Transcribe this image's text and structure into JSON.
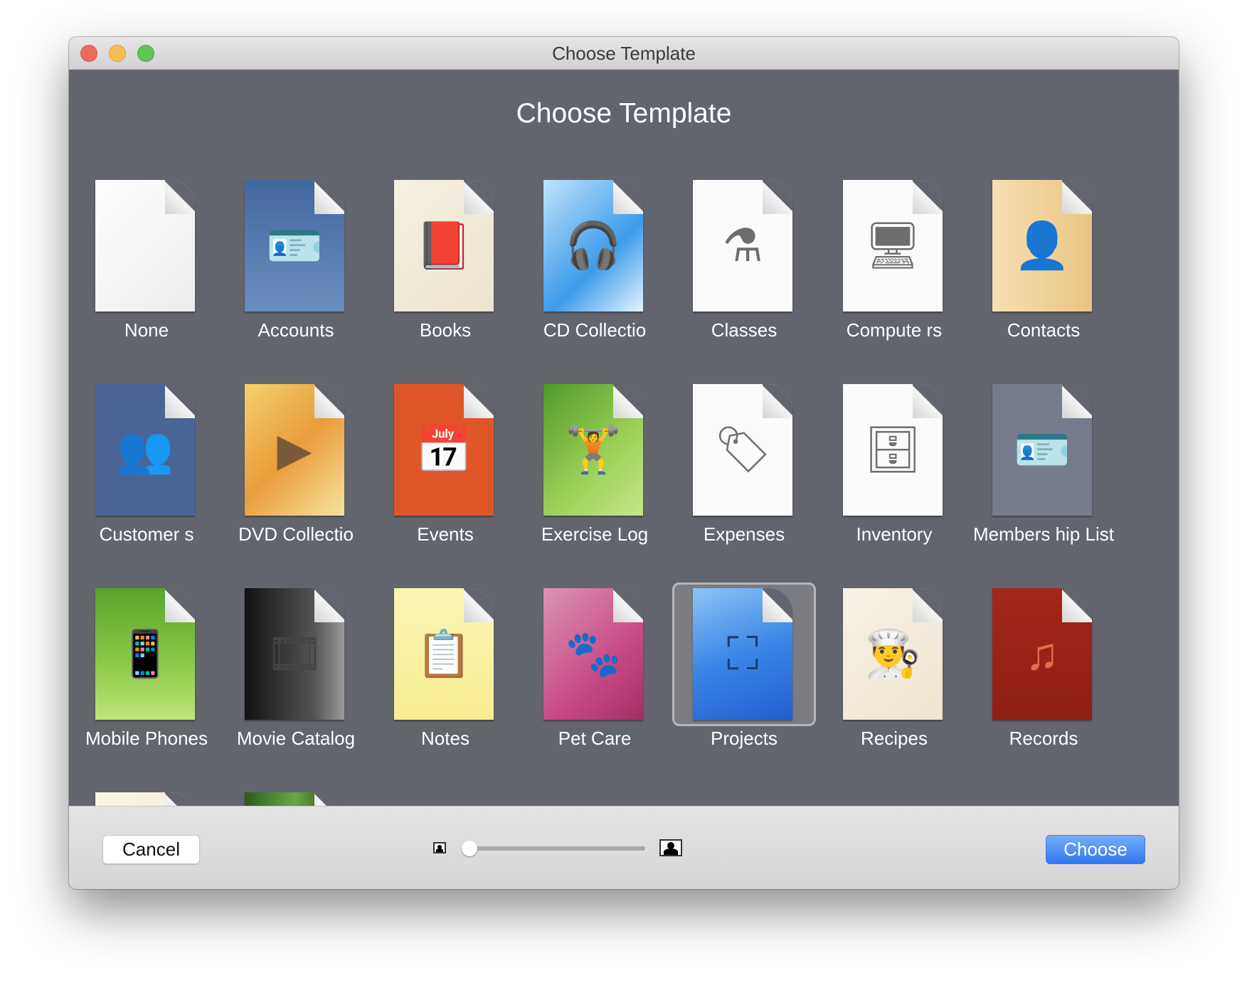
{
  "window": {
    "title": "Choose Template"
  },
  "heading": "Choose Template",
  "templates": [
    {
      "label": "None",
      "icon": "blank-document-icon",
      "glyph": "",
      "bg": "linear-gradient(135deg,#ffffff,#ececec)",
      "glyph_color": "#777"
    },
    {
      "label": "Accounts",
      "icon": "id-badge-icon",
      "glyph": "🪪",
      "bg": "linear-gradient(#43679d,#6a8fbf)",
      "glyph_color": "#243650"
    },
    {
      "label": "Books",
      "icon": "book-icon",
      "glyph": "📕",
      "bg": "linear-gradient(135deg,#f6f0e2,#ede4d0)",
      "glyph_color": "#6f6a62"
    },
    {
      "label": "CD Collectio",
      "icon": "headphones-icon",
      "glyph": "🎧",
      "bg": "linear-gradient(135deg,#bfe4fb,#3c9bea 60%,#e6f4fd)",
      "glyph_color": "#2d4e6a"
    },
    {
      "label": "Classes",
      "icon": "flask-icon",
      "glyph": "⚗",
      "bg": "#fbfbfb",
      "glyph_color": "#6d6d6d"
    },
    {
      "label": "Compute rs",
      "icon": "monitor-icon",
      "glyph": "🖥",
      "bg": "#fbfbfb",
      "glyph_color": "#6d6d6d"
    },
    {
      "label": "Contacts",
      "icon": "person-icon",
      "glyph": "👤",
      "bg": "linear-gradient(90deg,#f6e0b3,#e9c582)",
      "glyph_color": "#6d5a3c"
    },
    {
      "label": "Customer s",
      "icon": "group-icon",
      "glyph": "👥",
      "bg": "#4a6595",
      "glyph_color": "#20314f"
    },
    {
      "label": "DVD Collectio",
      "icon": "play-disc-icon",
      "glyph": "▶",
      "bg": "linear-gradient(135deg,#f3d26e,#ea9c3a 50%,#f5e3a0)",
      "glyph_color": "#7a5a36"
    },
    {
      "label": "Events",
      "icon": "calendar-icon",
      "glyph": "📅",
      "bg": "#df5628",
      "glyph_color": "#7a2a10"
    },
    {
      "label": "Exercise Log",
      "icon": "dumbbell-icon",
      "glyph": "🏋",
      "bg": "linear-gradient(135deg,#4f9a2a,#9ed25a 60%,#c6e58a)",
      "glyph_color": "#2f5a1a"
    },
    {
      "label": "Expenses",
      "icon": "price-tag-icon",
      "glyph": "🏷",
      "bg": "#fbfbfb",
      "glyph_color": "#707070"
    },
    {
      "label": "Inventory",
      "icon": "inbox-tray-icon",
      "glyph": "🗄",
      "bg": "#fbfbfb",
      "glyph_color": "#707070"
    },
    {
      "label": "Members hip List",
      "icon": "member-card-icon",
      "glyph": "🪪",
      "bg": "#767c8c",
      "glyph_color": "#2b2f38"
    },
    {
      "label": "Mobile Phones",
      "icon": "phone-icon",
      "glyph": "📱",
      "bg": "linear-gradient(#5aa32a,#8dcc4a 60%,#c2e37a)",
      "glyph_color": "#233818"
    },
    {
      "label": "Movie Catalog",
      "icon": "film-strip-icon",
      "glyph": "🎞",
      "bg": "linear-gradient(90deg,#111,#555 70%,#999)",
      "glyph_color": "#444"
    },
    {
      "label": "Notes",
      "icon": "notepad-icon",
      "glyph": "📋",
      "bg": "linear-gradient(#fbf5b5,#f7ed92)",
      "glyph_color": "#6e6a45"
    },
    {
      "label": "Pet Care",
      "icon": "paw-icon",
      "glyph": "🐾",
      "bg": "linear-gradient(135deg,#d995b3,#c94a86 60%,#a32e63)",
      "glyph_color": "#6a1d3e"
    },
    {
      "label": "Projects",
      "icon": "org-chart-icon",
      "glyph": "⛶",
      "bg": "linear-gradient(160deg,#8cc4f5,#3b86e6 50%,#1f5fcf)",
      "glyph_color": "#1e3d6e",
      "selected": true
    },
    {
      "label": "Recipes",
      "icon": "chef-hat-icon",
      "glyph": "👨‍🍳",
      "bg": "linear-gradient(135deg,#f7f1e6,#efe4d0)",
      "glyph_color": "#6d6a66"
    },
    {
      "label": "Records",
      "icon": "music-note-icon",
      "glyph": "♫",
      "bg": "linear-gradient(#a3261a,#8e1f12)",
      "glyph_color": "#e0704a"
    },
    {
      "label": "",
      "icon": "partial-template-icon",
      "glyph": "",
      "bg": "linear-gradient(135deg,#faf4e6,#efe7d3)",
      "glyph_color": "#777"
    },
    {
      "label": "",
      "icon": "partial-nature-template-icon",
      "glyph": "",
      "bg": "linear-gradient(90deg,#2c5a22,#6aa64a,#1e3f18)",
      "glyph_color": "#777"
    }
  ],
  "footer": {
    "cancel_label": "Cancel",
    "choose_label": "Choose",
    "zoom_slider_value": 0,
    "accent": "#3a82f6"
  }
}
